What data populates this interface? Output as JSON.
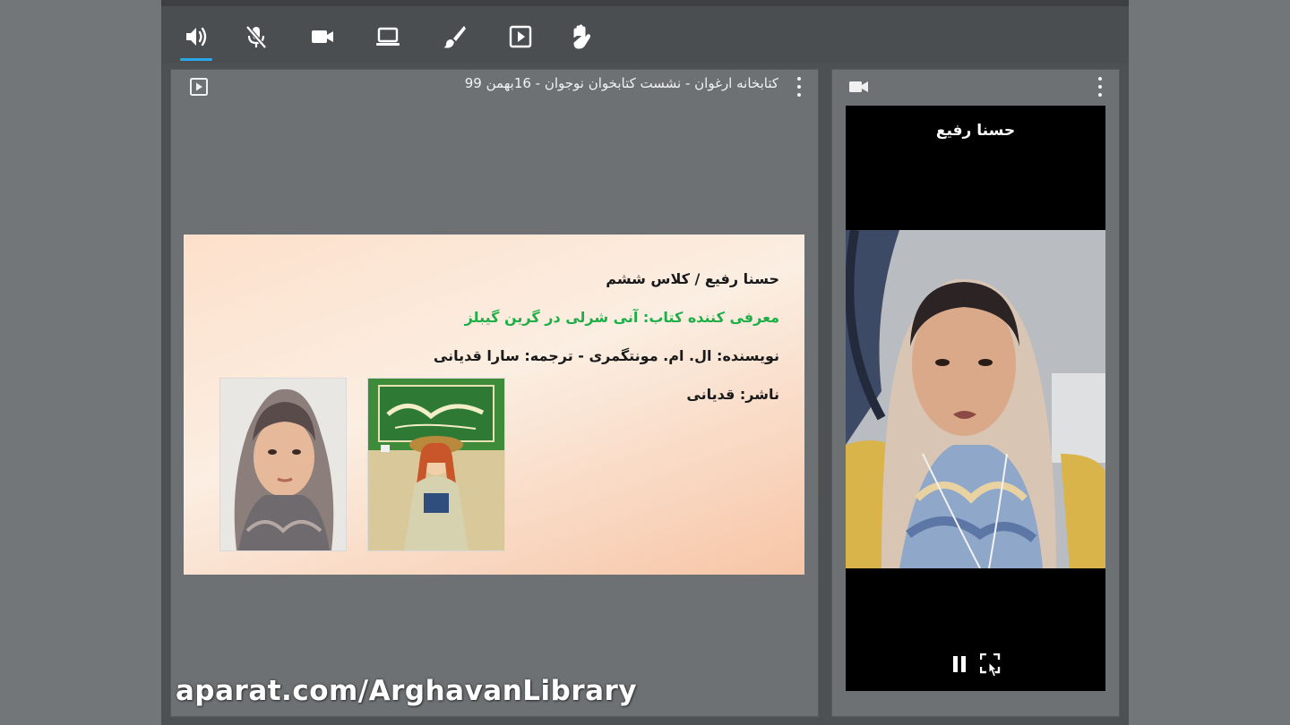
{
  "toolbar": {
    "buttons": [
      {
        "icon": "speaker-icon",
        "active": true
      },
      {
        "icon": "microphone-muted-icon"
      },
      {
        "icon": "video-camera-icon"
      },
      {
        "icon": "screen-share-icon"
      },
      {
        "icon": "brush-icon"
      },
      {
        "icon": "play-media-icon"
      },
      {
        "icon": "raise-hand-icon"
      }
    ]
  },
  "main_panel": {
    "title": "کتابخانه ارغوان - نشست کتابخوان نوجوان - 16بهمن 99",
    "slide": {
      "line1": "حسنا رفیع / کلاس ششم",
      "line2": "معرفی کننده کتاب: آنی شرلی در گرین گیبلز",
      "line3": "نویسنده: ال. ام. مونتگمری - ترجمه: سارا قدیانی",
      "line4": "ناشر: قدیانی"
    }
  },
  "side_panel": {
    "participant_name": "حسنا رفیع"
  },
  "watermark": "aparat.com/ArghavanLibrary",
  "colors": {
    "accent": "#2aa7e6",
    "slide_green": "#1eae47",
    "panel_bg": "#6e7173",
    "toolbar_bg": "#4b4e51"
  }
}
